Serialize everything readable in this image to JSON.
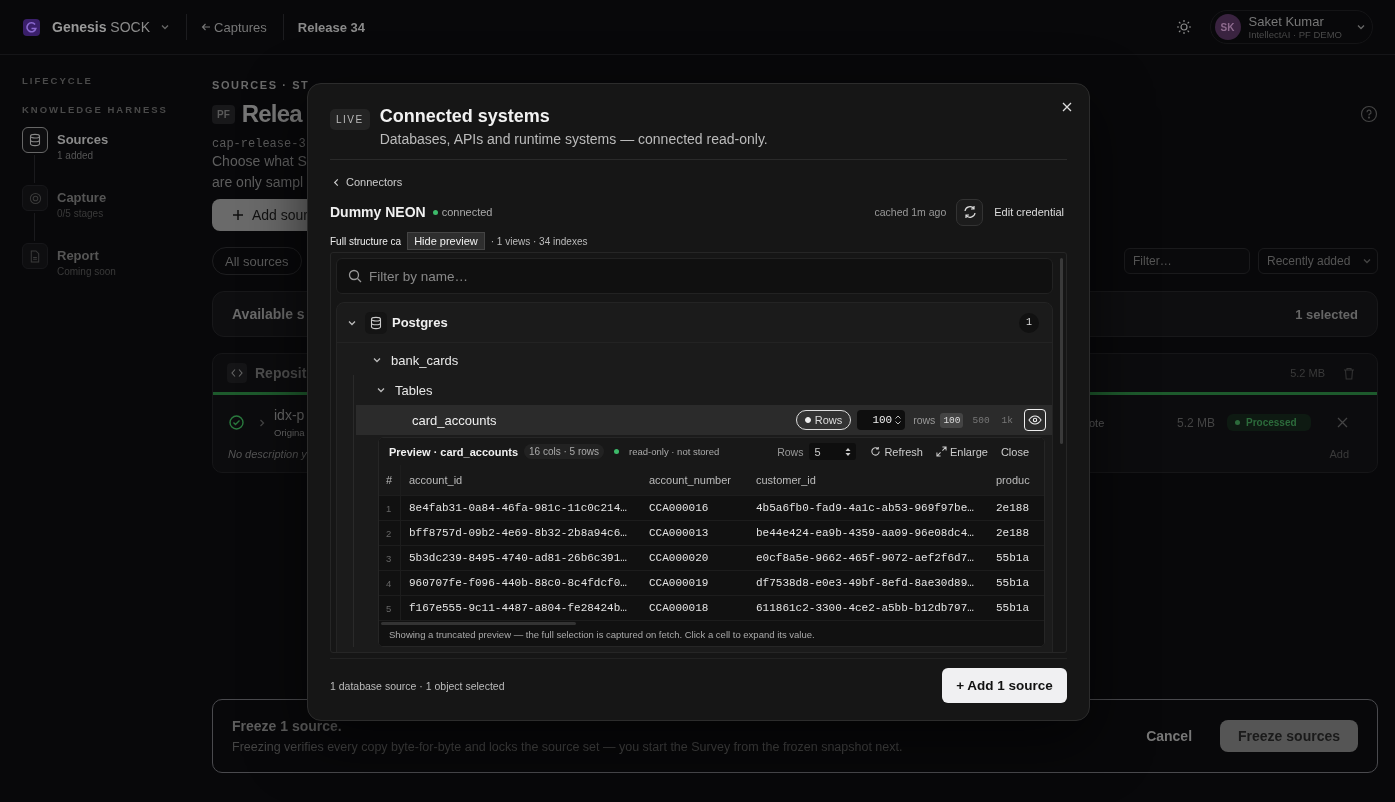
{
  "header": {
    "brand": "Genesis",
    "brand_suffix": "SOCK",
    "back_link": "Captures",
    "breadcrumb": "Release 34",
    "user": {
      "initials": "SK",
      "name": "Saket Kumar",
      "org": "IntellectAI · PF DEMO"
    }
  },
  "sidebar": {
    "section": "LIFECYCLE",
    "group": "KNOWLEDGE HARNESS",
    "steps": [
      {
        "kind": "database",
        "title": "Sources",
        "subtitle": "1 added",
        "selected": true
      },
      {
        "kind": "target",
        "title": "Capture",
        "subtitle": "0/5 stages",
        "selected": false
      },
      {
        "kind": "document",
        "title": "Report",
        "subtitle": "Coming soon",
        "selected": false
      }
    ]
  },
  "page": {
    "eyebrow": "SOURCES · ST",
    "badge": "PF",
    "title": "Relea",
    "slug": "cap-release-3",
    "description": [
      "Choose what S",
      "are only sampl"
    ],
    "add_button": "Add sour",
    "filter_chip": "All sources",
    "filter": {
      "placeholder": "Filter…"
    },
    "sort": "Recently added",
    "available": {
      "title": "Available s",
      "count": "1 selected"
    },
    "repository": {
      "title": "Reposit",
      "size": "5.2 MB",
      "level": 1,
      "item": {
        "name": "idx-p",
        "subtitle": "Origina",
        "column_3": "ote",
        "size": "5.2 MB",
        "status": "Processed",
        "description": "No description y",
        "add": "Add"
      }
    }
  },
  "freeze": {
    "title": "Freeze 1 source.",
    "text": "Freezing verifies every copy byte-for-byte and locks the source set — you start the Survey from the frozen snapshot next.",
    "cancel": "Cancel",
    "confirm": "Freeze sources"
  },
  "modal": {
    "badge": "LIVE",
    "title": "Connected systems",
    "subtitle": "Databases, APIs and runtime systems — connected read-only.",
    "back": "Connectors",
    "connector": {
      "name": "Dummy NEON",
      "status": "connected",
      "cached": "cached 1m ago",
      "edit": "Edit credential"
    },
    "summary_start": "Full structure ca",
    "summary_end": "· 1 views · 34 indexes",
    "tooltip": "Hide preview",
    "search": {
      "placeholder": "Filter by name…"
    },
    "tree": [
      {
        "kind": "engine",
        "label": "Postgres",
        "count": "1",
        "expanded": true,
        "children": [
          {
            "kind": "schema",
            "label": "bank_cards",
            "expanded": true,
            "children": [
              {
                "kind": "group",
                "label": "Tables",
                "expanded": true,
                "children": [
                  {
                    "kind": "table",
                    "label": "card_accounts",
                    "selected": true,
                    "limit": {
                      "mode": "Rows",
                      "mode_on": true,
                      "value": "100",
                      "unit": "rows",
                      "preview_on": true,
                      "presets": [
                        {
                          "label": "100",
                          "selected": true
                        },
                        {
                          "label": "500",
                          "selected": false
                        },
                        {
                          "label": "1k",
                          "selected": false
                        }
                      ]
                    },
                    "preview": {
                      "title": "Preview · card_accounts",
                      "meta": "16 cols · 5 rows",
                      "note": "read-only · not stored",
                      "rows_label": "Rows",
                      "rows_value": "5",
                      "refresh": "Refresh",
                      "enlarge": "Enlarge",
                      "close": "Close",
                      "columns": [
                        "#",
                        "account_id",
                        "account_number",
                        "customer_id",
                        "produc"
                      ],
                      "rows": [
                        [
                          "1",
                          "8e4fab31-0a84-46fa-981c-11c0c214…",
                          "CCA000016",
                          "4b5a6fb0-fad9-4a1c-ab53-969f97be…",
                          "2e188"
                        ],
                        [
                          "2",
                          "bff8757d-09b2-4e69-8b32-2b8a94c6…",
                          "CCA000013",
                          "be44e424-ea9b-4359-aa09-96e08dc4…",
                          "2e188"
                        ],
                        [
                          "3",
                          "5b3dc239-8495-4740-ad81-26b6c391…",
                          "CCA000020",
                          "e0cf8a5e-9662-465f-9072-aef2f6d7…",
                          "55b1a"
                        ],
                        [
                          "4",
                          "960707fe-f096-440b-88c0-8c4fdcf0…",
                          "CCA000019",
                          "df7538d8-e0e3-49bf-8efd-8ae30d89…",
                          "55b1a"
                        ],
                        [
                          "5",
                          "f167e555-9c11-4487-a804-fe28424b…",
                          "CCA000018",
                          "611861c2-3300-4ce2-a5bb-b12db797…",
                          "55b1a"
                        ]
                      ],
                      "footer": "Showing a truncated preview — the full selection is captured on fetch. Click a cell to expand its value."
                    }
                  }
                ]
              }
            ]
          }
        ]
      }
    ],
    "footer": {
      "summary": "1 database source · 1 object selected",
      "add": "+ Add 1 source"
    }
  }
}
